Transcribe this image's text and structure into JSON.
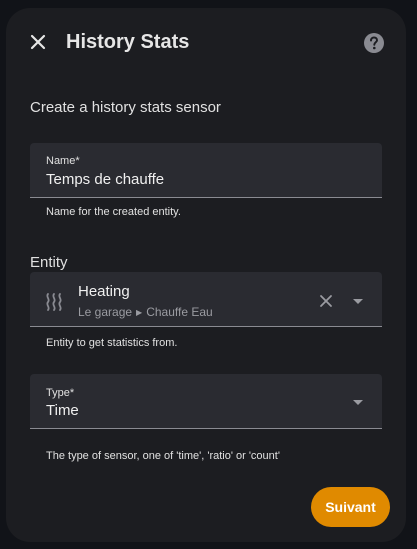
{
  "dialog": {
    "title": "History Stats",
    "intro": "Create a history stats sensor"
  },
  "name_field": {
    "label": "Name*",
    "value": "Temps de chauffe",
    "helper": "Name for the created entity."
  },
  "entity_section": {
    "label": "Entity",
    "entity_name": "Heating",
    "area": "Le garage",
    "device": "Chauffe Eau",
    "helper": "Entity to get statistics from."
  },
  "type_field": {
    "label": "Type*",
    "value": "Time",
    "helper": "The type of sensor, one of 'time', 'ratio' or 'count'"
  },
  "actions": {
    "next_label": "Suivant"
  },
  "colors": {
    "accent": "#e08a00",
    "surface": "#1c1d21",
    "field": "#2a2b31"
  }
}
